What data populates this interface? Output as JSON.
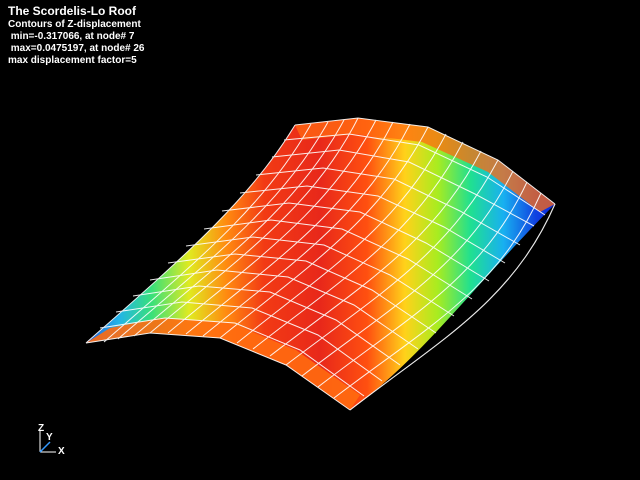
{
  "plot": {
    "title": "The Scordelis-Lo Roof",
    "subtitle": "Contours of Z-displacement",
    "min_line": " min=-0.317066, at node# 7",
    "max_line": " max=0.0475197, at node# 26",
    "factor_line": "max displacement factor=5"
  },
  "axes": {
    "z_label": "Z",
    "y_label": "Y",
    "x_label": "X"
  },
  "colors": {
    "background": "#000000",
    "mesh_lines": "#ffffff",
    "text": "#ffffff",
    "triad_x": "#ffffff",
    "triad_y": "#3399ff",
    "triad_z": "#ffffff"
  }
}
